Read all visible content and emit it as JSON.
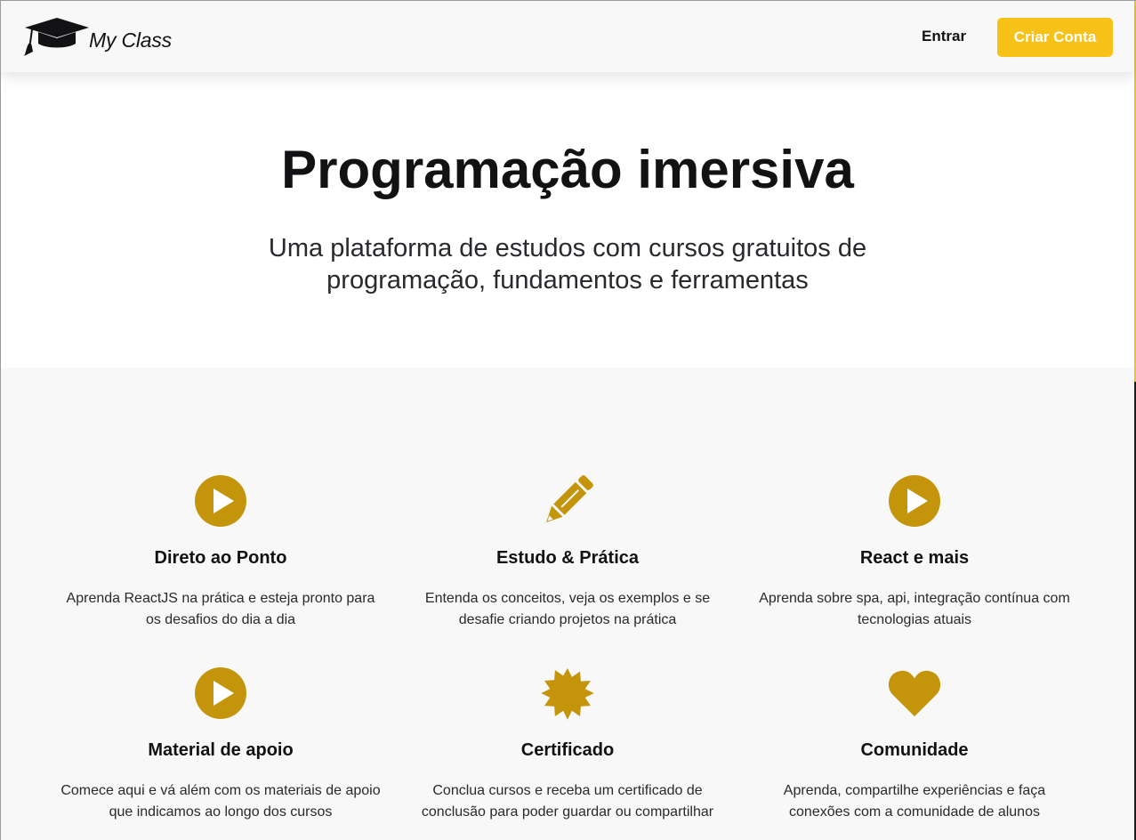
{
  "colors": {
    "accent": "#f7c118",
    "icon": "#c4950a",
    "text": "#121214",
    "header_bg": "#f8f8f8",
    "features_bg": "#f8f8f8"
  },
  "header": {
    "logo_icon": "graduation-cap-icon",
    "logo_text": "My Class",
    "login_label": "Entrar",
    "signup_label": "Criar Conta"
  },
  "hero": {
    "title": "Programação imersiva",
    "subtitle": "Uma plataforma de estudos com cursos gratuitos de programação, fundamentos e ferramentas"
  },
  "features": [
    {
      "icon": "play-circle-icon",
      "title": "Direto ao Ponto",
      "description": "Aprenda ReactJS na prática e esteja pronto para os desafios do dia a dia"
    },
    {
      "icon": "pencil-icon",
      "title": "Estudo & Prática",
      "description": "Entenda os conceitos, veja os exemplos e se desafie criando projetos na prática"
    },
    {
      "icon": "play-circle-icon",
      "title": "React e mais",
      "description": "Aprenda sobre spa, api, integração contínua com tecnologias atuais"
    },
    {
      "icon": "play-circle-icon",
      "title": "Material de apoio",
      "description": "Comece aqui e vá além com os materiais de apoio que indicamos ao longo dos cursos"
    },
    {
      "icon": "certificate-icon",
      "title": "Certificado",
      "description": "Conclua cursos e receba um certificado de conclusão para poder guardar ou compartilhar"
    },
    {
      "icon": "heart-icon",
      "title": "Comunidade",
      "description": "Aprenda, compartilhe experiências e faça conexões com a comunidade de alunos"
    }
  ]
}
